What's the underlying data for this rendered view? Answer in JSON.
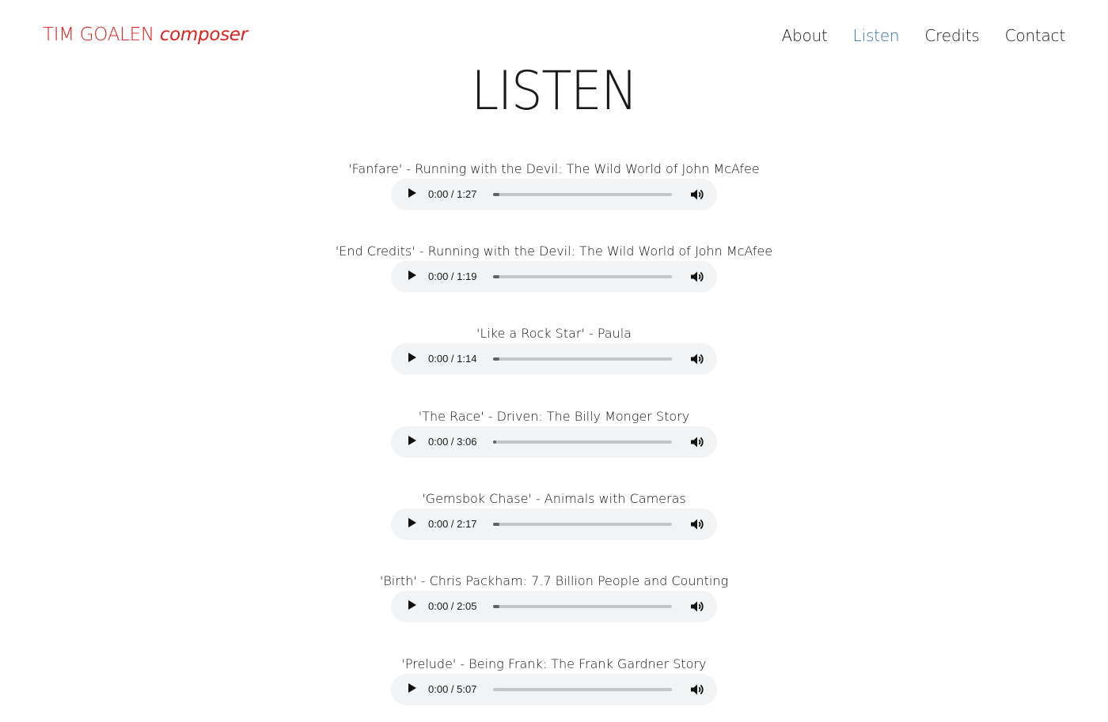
{
  "header": {
    "name": "TIM GOALEN",
    "role": "composer"
  },
  "nav": [
    {
      "label": "About",
      "active": false
    },
    {
      "label": "Listen",
      "active": true
    },
    {
      "label": "Credits",
      "active": false
    },
    {
      "label": "Contact",
      "active": false
    }
  ],
  "page": {
    "heading": "LISTEN"
  },
  "colors": {
    "brand_red": "#e0201c",
    "nav_active": "#2a72b5",
    "player_bg": "#f1f3f4"
  },
  "tracks": [
    {
      "title": "'Fanfare' - Running with the Devil: The Wild World of John McAfee",
      "time": "0:00 / 1:27",
      "icons": [
        "play-icon",
        "volume-icon"
      ]
    },
    {
      "title": "'End Credits' - Running with the Devil: The Wild World of John McAfee",
      "time": "0:00 / 1:19",
      "icons": [
        "play-icon",
        "volume-icon"
      ]
    },
    {
      "title": "'Like a Rock Star' - Paula",
      "time": "0:00 / 1:14",
      "icons": [
        "play-icon",
        "volume-icon"
      ]
    },
    {
      "title": "'The Race' - Driven: The Billy Monger Story",
      "time": "0:00 / 3:06",
      "icons": [
        "play-icon",
        "volume-icon"
      ]
    },
    {
      "title": "'Gemsbok Chase' - Animals with Cameras",
      "time": "0:00 / 2:17",
      "icons": [
        "play-icon",
        "volume-icon"
      ]
    },
    {
      "title": "'Birth' - Chris Packham: 7.7 Billion People and Counting",
      "time": "0:00 / 2:05",
      "icons": [
        "play-icon",
        "volume-icon"
      ]
    },
    {
      "title": "'Prelude' - Being Frank: The Frank Gardner Story",
      "time": "0:00 / 5:07",
      "icons": [
        "play-icon",
        "volume-icon"
      ]
    }
  ]
}
